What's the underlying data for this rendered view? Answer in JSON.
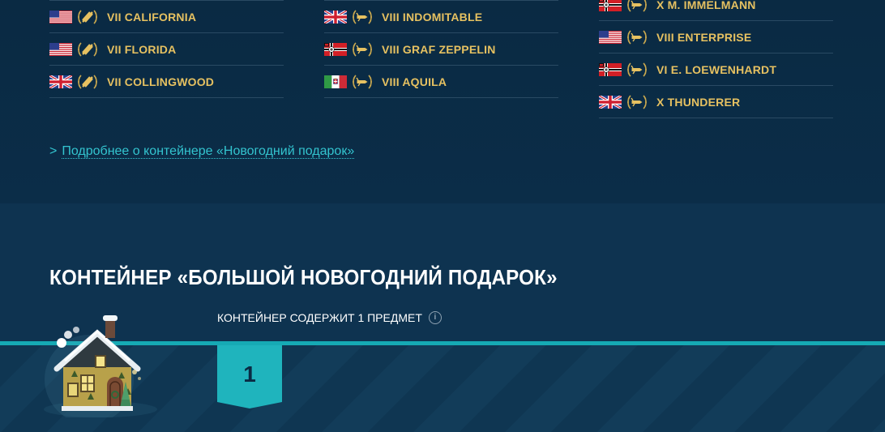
{
  "ship_columns": [
    [
      {
        "flag": "usa",
        "tier_name": "VII CALIFORNIA"
      },
      {
        "flag": "usa",
        "tier_name": "VII FLORIDA"
      },
      {
        "flag": "uk",
        "tier_name": "VII COLLINGWOOD"
      }
    ],
    [
      {
        "flag": "uk",
        "tier_name": "VIII INDOMITABLE"
      },
      {
        "flag": "germany",
        "tier_name": "VIII GRAF ZEPPELIN"
      },
      {
        "flag": "italy",
        "tier_name": "VIII AQUILA"
      }
    ],
    [
      {
        "flag": "germany",
        "tier_name": "X M. IMMELMANN"
      },
      {
        "flag": "usa",
        "tier_name": "VIII ENTERPRISE"
      },
      {
        "flag": "germany",
        "tier_name": "VI E. LOEWENHARDT"
      },
      {
        "flag": "uk",
        "tier_name": "X THUNDERER"
      }
    ]
  ],
  "more_link": {
    "chevron": ">",
    "text": "Подробнее о контейнере «Новогодний подарок»"
  },
  "container": {
    "title": "КОНТЕЙНЕР «БОЛЬШОЙ НОВОГОДНИЙ ПОДАРОК»",
    "contains_text": "КОНТЕЙНЕР СОДЕРЖИТ 1 ПРЕДМЕТ",
    "info_icon": "i",
    "item_count": "1"
  },
  "colors": {
    "background": "#0b2a43",
    "accent": "#16aab4",
    "ship_name": "#e6c161",
    "link": "#33c4cf"
  }
}
